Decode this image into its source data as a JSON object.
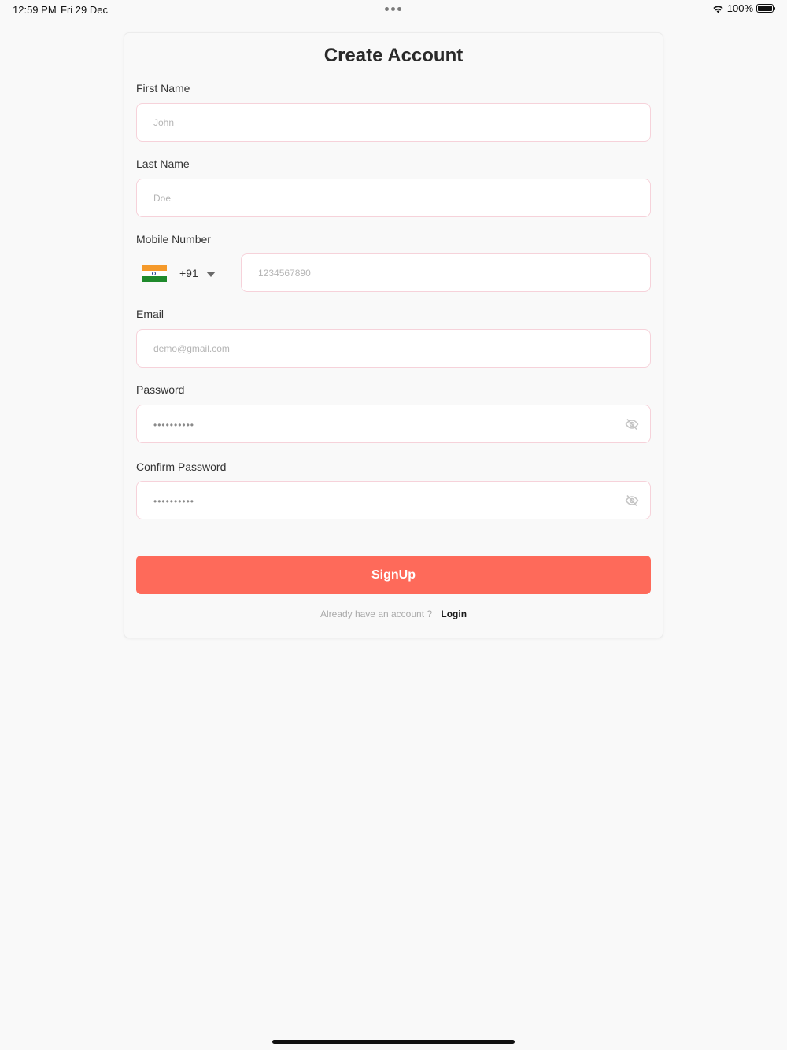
{
  "status_bar": {
    "time": "12:59 PM",
    "date": "Fri 29 Dec",
    "battery": "100%",
    "icons": [
      "wifi-icon",
      "battery-icon"
    ]
  },
  "form": {
    "title": "Create Account",
    "first_name": {
      "label": "First Name",
      "placeholder": "John"
    },
    "last_name": {
      "label": "Last Name",
      "placeholder": "Doe"
    },
    "mobile": {
      "label": "Mobile Number",
      "country_code": "+91",
      "country_flag": "india-flag-icon",
      "placeholder": "1234567890"
    },
    "email": {
      "label": "Email",
      "placeholder": "demo@gmail.com"
    },
    "password": {
      "label": "Password",
      "masked_value": "••••••••••",
      "toggle_icon": "eye-off-icon"
    },
    "confirm_password": {
      "label": "Confirm Password",
      "masked_value": "••••••••••",
      "toggle_icon": "eye-off-icon"
    },
    "submit_label": "SignUp",
    "login_prompt": "Already have an account ?",
    "login_link": "Login"
  },
  "colors": {
    "accent": "#fe6a5a",
    "input_border": "#f6d2da",
    "background": "#f9f9f9"
  }
}
